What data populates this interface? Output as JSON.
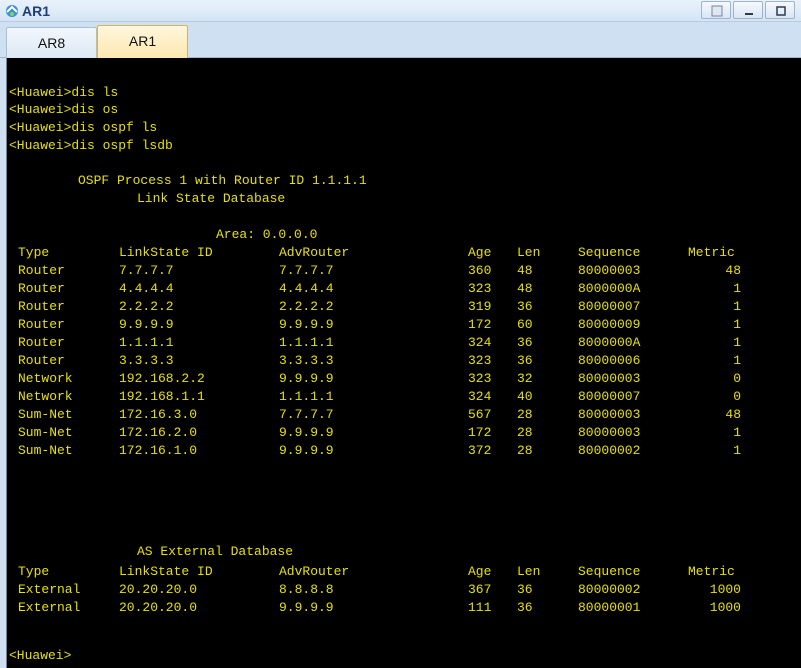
{
  "window": {
    "title": "AR1",
    "app_icon": "ensp-app-icon",
    "buttons": [
      "restore-icon",
      "minimize-icon",
      "maximize-icon"
    ]
  },
  "tabs": [
    {
      "label": "AR8",
      "active": false
    },
    {
      "label": "AR1",
      "active": true
    }
  ],
  "terminal": {
    "text_color": "#e7e000",
    "background": "#000000",
    "commands": [
      "<Huawei>dis ls",
      "<Huawei>dis os",
      "<Huawei>dis ospf ls",
      "<Huawei>dis ospf lsdb"
    ],
    "process_header": "OSPF Process 1 with Router ID 1.1.1.1",
    "db_title": "Link State Database",
    "area": "Area: 0.0.0.0",
    "columns": [
      "Type",
      "LinkState ID",
      "AdvRouter",
      "Age",
      "Len",
      "Sequence",
      "Metric"
    ],
    "lsdb_rows": [
      [
        "Router",
        "7.7.7.7",
        "7.7.7.7",
        "360",
        "48",
        "80000003",
        "48"
      ],
      [
        "Router",
        "4.4.4.4",
        "4.4.4.4",
        "323",
        "48",
        "8000000A",
        "1"
      ],
      [
        "Router",
        "2.2.2.2",
        "2.2.2.2",
        "319",
        "36",
        "80000007",
        "1"
      ],
      [
        "Router",
        "9.9.9.9",
        "9.9.9.9",
        "172",
        "60",
        "80000009",
        "1"
      ],
      [
        "Router",
        "1.1.1.1",
        "1.1.1.1",
        "324",
        "36",
        "8000000A",
        "1"
      ],
      [
        "Router",
        "3.3.3.3",
        "3.3.3.3",
        "323",
        "36",
        "80000006",
        "1"
      ],
      [
        "Network",
        "192.168.2.2",
        "9.9.9.9",
        "323",
        "32",
        "80000003",
        "0"
      ],
      [
        "Network",
        "192.168.1.1",
        "1.1.1.1",
        "324",
        "40",
        "80000007",
        "0"
      ],
      [
        "Sum-Net",
        "172.16.3.0",
        "7.7.7.7",
        "567",
        "28",
        "80000003",
        "48"
      ],
      [
        "Sum-Net",
        "172.16.2.0",
        "9.9.9.9",
        "172",
        "28",
        "80000003",
        "1"
      ],
      [
        "Sum-Net",
        "172.16.1.0",
        "9.9.9.9",
        "372",
        "28",
        "80000002",
        "1"
      ]
    ],
    "ext_title": "AS External Database",
    "ext_rows": [
      [
        "External",
        "20.20.20.0",
        "8.8.8.8",
        "367",
        "36",
        "80000002",
        "1000"
      ],
      [
        "External",
        "20.20.20.0",
        "9.9.9.9",
        "111",
        "36",
        "80000001",
        "1000"
      ]
    ],
    "prompt": "<Huawei>"
  }
}
